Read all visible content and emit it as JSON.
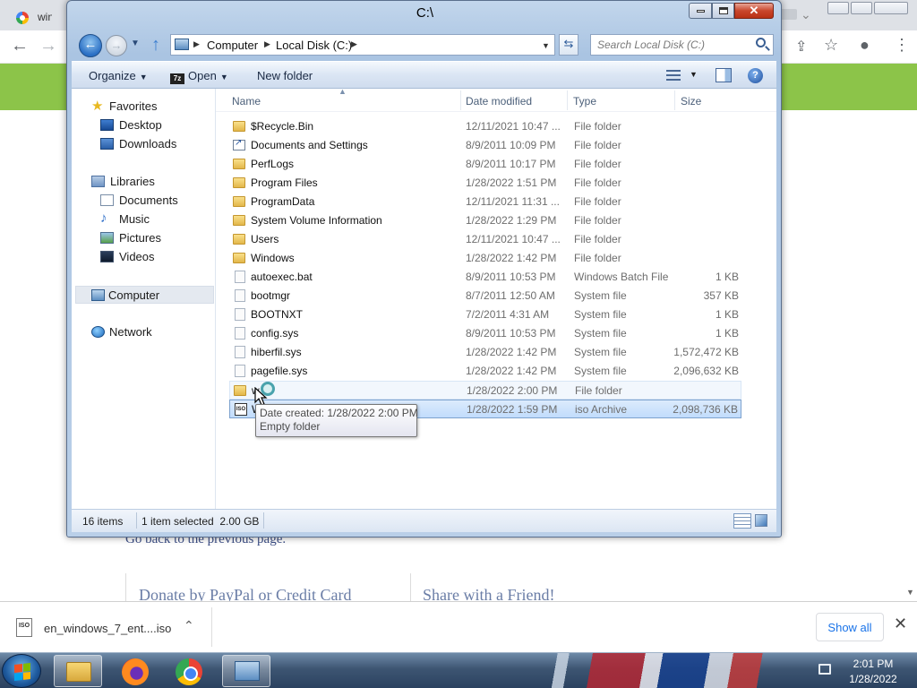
{
  "browser": {
    "tabs": [
      {
        "title": "windo"
      }
    ],
    "colors": {
      "accent_band": "#8cc449"
    },
    "toolbar_icons": [
      "back-arrow-icon",
      "forward-arrow-icon",
      "share-icon",
      "star-icon",
      "profile-icon",
      "menu-icon"
    ]
  },
  "page": {
    "go_back": "Go back to the previous page.",
    "donate_heading": "Donate by PayPal or Credit Card",
    "share_heading": "Share with a Friend!"
  },
  "download_bar": {
    "filename": "en_windows_7_ent....iso",
    "icon_label": "ISO",
    "show_all": "Show all"
  },
  "explorer": {
    "title": "C:\\",
    "breadcrumbs": [
      "Computer",
      "Local Disk (C:)"
    ],
    "search_placeholder": "Search Local Disk (C:)",
    "commands": {
      "organize": "Organize",
      "open": "Open",
      "open_icon_label": "7z",
      "new_folder": "New folder"
    },
    "nav": {
      "favorites": "Favorites",
      "desktop": "Desktop",
      "downloads": "Downloads",
      "libraries": "Libraries",
      "documents": "Documents",
      "music": "Music",
      "pictures": "Pictures",
      "videos": "Videos",
      "computer": "Computer",
      "network": "Network"
    },
    "columns": {
      "name": "Name",
      "date_modified": "Date modified",
      "type": "Type",
      "size": "Size"
    },
    "files": [
      {
        "name": "$Recycle.Bin",
        "date": "12/11/2021 10:47 ...",
        "type": "File folder",
        "size": "",
        "icon": "folder"
      },
      {
        "name": "Documents and Settings",
        "date": "8/9/2011 10:09 PM",
        "type": "File folder",
        "size": "",
        "icon": "folder-shortcut"
      },
      {
        "name": "PerfLogs",
        "date": "8/9/2011 10:17 PM",
        "type": "File folder",
        "size": "",
        "icon": "folder"
      },
      {
        "name": "Program Files",
        "date": "1/28/2022 1:51 PM",
        "type": "File folder",
        "size": "",
        "icon": "folder"
      },
      {
        "name": "ProgramData",
        "date": "12/11/2021 11:31 ...",
        "type": "File folder",
        "size": "",
        "icon": "folder"
      },
      {
        "name": "System Volume Information",
        "date": "1/28/2022 1:29 PM",
        "type": "File folder",
        "size": "",
        "icon": "folder"
      },
      {
        "name": "Users",
        "date": "12/11/2021 10:47 ...",
        "type": "File folder",
        "size": "",
        "icon": "folder"
      },
      {
        "name": "Windows",
        "date": "1/28/2022 1:42 PM",
        "type": "File folder",
        "size": "",
        "icon": "folder"
      },
      {
        "name": "autoexec.bat",
        "date": "8/9/2011 10:53 PM",
        "type": "Windows Batch File",
        "size": "1 KB",
        "icon": "file"
      },
      {
        "name": "bootmgr",
        "date": "8/7/2011 12:50 AM",
        "type": "System file",
        "size": "357 KB",
        "icon": "file"
      },
      {
        "name": "BOOTNXT",
        "date": "7/2/2011 4:31 AM",
        "type": "System file",
        "size": "1 KB",
        "icon": "file"
      },
      {
        "name": "config.sys",
        "date": "8/9/2011 10:53 PM",
        "type": "System file",
        "size": "1 KB",
        "icon": "file"
      },
      {
        "name": "hiberfil.sys",
        "date": "1/28/2022 1:42 PM",
        "type": "System file",
        "size": "1,572,472 KB",
        "icon": "file"
      },
      {
        "name": "pagefile.sys",
        "date": "1/28/2022 1:42 PM",
        "type": "System file",
        "size": "2,096,632 KB",
        "icon": "file"
      },
      {
        "name": "w",
        "date": "1/28/2022 2:00 PM",
        "type": "File folder",
        "size": "",
        "icon": "folder",
        "state": "hover"
      },
      {
        "name": "W",
        "date": "1/28/2022 1:59 PM",
        "type": "iso Archive",
        "size": "2,098,736 KB",
        "icon": "iso",
        "state": "selected"
      }
    ],
    "tooltip": {
      "line1": "Date created: 1/28/2022 2:00 PM",
      "line2": "Empty folder"
    },
    "status": {
      "item_count": "16 items",
      "selection": "1 item selected  2.00 GB"
    }
  },
  "taskbar": {
    "time": "2:01 PM",
    "date": "1/28/2022",
    "apps": [
      "windows-explorer",
      "firefox",
      "chrome",
      "computer"
    ]
  }
}
